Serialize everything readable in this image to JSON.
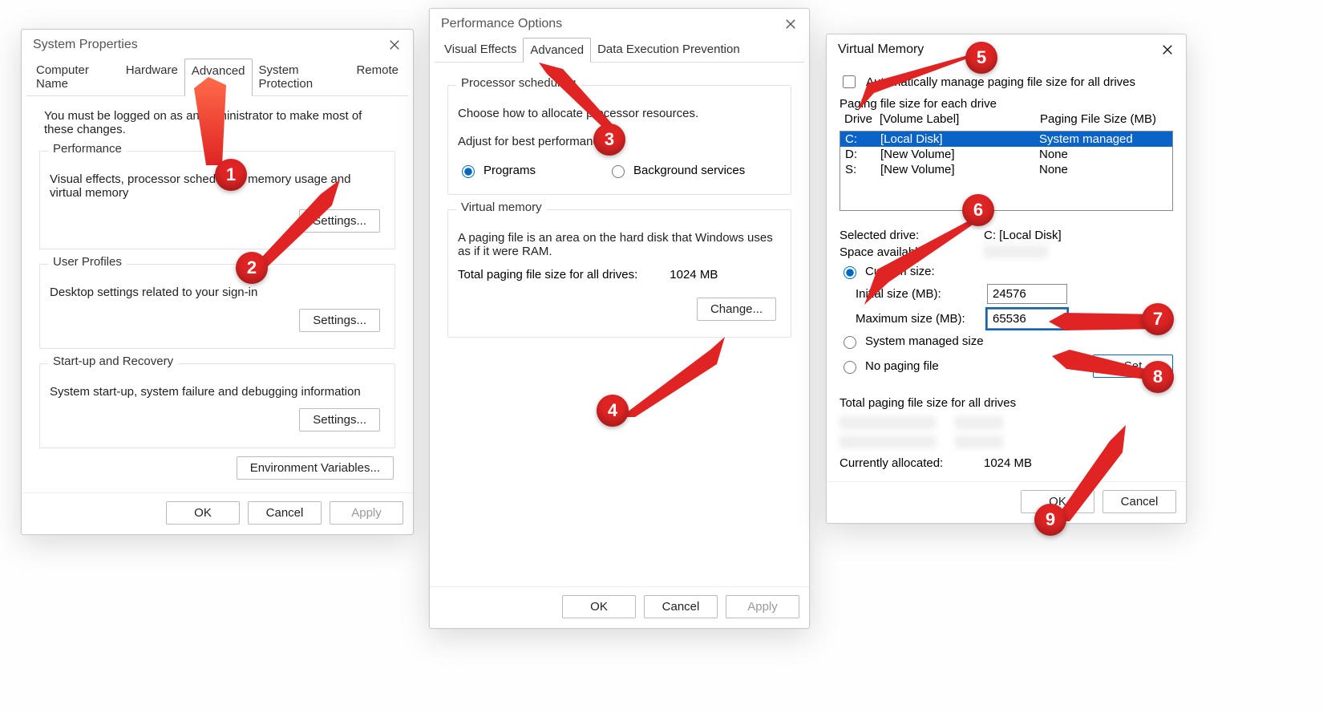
{
  "sysprops": {
    "title": "System Properties",
    "tabs": [
      "Computer Name",
      "Hardware",
      "Advanced",
      "System Protection",
      "Remote"
    ],
    "active_tab": 2,
    "message": "You must be logged on as an Administrator to make most of these changes.",
    "groups": {
      "perf": {
        "title": "Performance",
        "desc": "Visual effects, processor scheduling, memory usage and virtual memory",
        "btn": "Settings..."
      },
      "profiles": {
        "title": "User Profiles",
        "desc": "Desktop settings related to your sign-in",
        "btn": "Settings..."
      },
      "startup": {
        "title": "Start-up and Recovery",
        "desc": "System start-up, system failure and debugging information",
        "btn": "Settings..."
      }
    },
    "env_btn": "Environment Variables...",
    "buttons": {
      "ok": "OK",
      "cancel": "Cancel",
      "apply": "Apply"
    }
  },
  "perfopt": {
    "title": "Performance Options",
    "tabs": [
      "Visual Effects",
      "Advanced",
      "Data Execution Prevention"
    ],
    "active_tab": 1,
    "proc": {
      "title": "Processor scheduling",
      "desc": "Choose how to allocate processor resources.",
      "adjust": "Adjust for best performance of:",
      "programs": "Programs",
      "bg": "Background services"
    },
    "vm": {
      "title": "Virtual memory",
      "desc": "A paging file is an area on the hard disk that Windows uses as if it were RAM.",
      "total_label": "Total paging file size for all drives:",
      "total_value": "1024 MB",
      "change": "Change..."
    },
    "buttons": {
      "ok": "OK",
      "cancel": "Cancel",
      "apply": "Apply"
    }
  },
  "vmd": {
    "title": "Virtual Memory",
    "auto_label": "Automatically manage paging file size for all drives",
    "section_label": "Paging file size for each drive",
    "cols": {
      "drive": "Drive",
      "vol": "[Volume Label]",
      "pfs": "Paging File Size (MB)"
    },
    "rows": [
      {
        "d": "C:",
        "v": "[Local Disk]",
        "p": "System managed",
        "selected": true
      },
      {
        "d": "D:",
        "v": "[New Volume]",
        "p": "None",
        "selected": false
      },
      {
        "d": "S:",
        "v": "[New Volume]",
        "p": "None",
        "selected": false
      }
    ],
    "selected_drive_label": "Selected drive:",
    "selected_drive_value": "C:  [Local Disk]",
    "space_label": "Space available:",
    "custom": "Custom size:",
    "initial_label": "Initial size (MB):",
    "initial_value": "24576",
    "max_label": "Maximum size (MB):",
    "max_value": "65536",
    "sys_managed": "System managed size",
    "no_paging": "No paging file",
    "set_btn": "Set",
    "total_section": "Total paging file size for all drives",
    "currently_label": "Currently allocated:",
    "currently_value": "1024 MB",
    "buttons": {
      "ok": "OK",
      "cancel": "Cancel"
    }
  },
  "annotations": [
    "1",
    "2",
    "3",
    "4",
    "5",
    "6",
    "7",
    "8",
    "9"
  ]
}
